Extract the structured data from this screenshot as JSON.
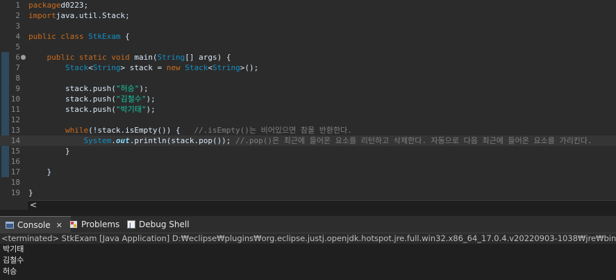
{
  "editor": {
    "lines": [
      {
        "num": "1",
        "tokens": [
          [
            "kw",
            "package"
          ],
          [
            "",
            "d0223;"
          ]
        ]
      },
      {
        "num": "2",
        "tokens": [
          [
            "kw",
            "import"
          ],
          [
            "",
            "java.util.Stack;"
          ]
        ]
      },
      {
        "num": "3",
        "tokens": []
      },
      {
        "num": "4",
        "tokens": [
          [
            "kw",
            "public class "
          ],
          [
            "cls",
            "StkExam"
          ],
          [
            "",
            " {"
          ]
        ]
      },
      {
        "num": "5",
        "tokens": []
      },
      {
        "num": "6",
        "tokens": [
          [
            "",
            "    "
          ],
          [
            "kw",
            "public static void "
          ],
          [
            "",
            "main("
          ],
          [
            "cls",
            "String"
          ],
          [
            "",
            "[] "
          ],
          [
            "",
            "args) {"
          ]
        ]
      },
      {
        "num": "7",
        "tokens": [
          [
            "",
            "        "
          ],
          [
            "cls",
            "Stack"
          ],
          [
            "",
            "<"
          ],
          [
            "cls",
            "String"
          ],
          [
            "",
            "> stack = "
          ],
          [
            "kw",
            "new "
          ],
          [
            "cls",
            "Stack"
          ],
          [
            "",
            "<"
          ],
          [
            "cls",
            "String"
          ],
          [
            "",
            ">();"
          ]
        ]
      },
      {
        "num": "8",
        "tokens": []
      },
      {
        "num": "9",
        "tokens": [
          [
            "",
            "        stack.push("
          ],
          [
            "str",
            "\"허승\""
          ],
          [
            "",
            ");"
          ]
        ]
      },
      {
        "num": "10",
        "tokens": [
          [
            "",
            "        stack.push("
          ],
          [
            "str",
            "\"김철수\""
          ],
          [
            "",
            ");"
          ]
        ]
      },
      {
        "num": "11",
        "tokens": [
          [
            "",
            "        stack.push("
          ],
          [
            "str",
            "\"박기태\""
          ],
          [
            "",
            ");"
          ]
        ]
      },
      {
        "num": "12",
        "tokens": []
      },
      {
        "num": "13",
        "tokens": [
          [
            "",
            "        "
          ],
          [
            "kw",
            "while"
          ],
          [
            "",
            "(!stack.isEmpty()) {   "
          ],
          [
            "cm",
            "//.isEmpty()는 비어있으면 참을 반환한다."
          ]
        ]
      },
      {
        "num": "14",
        "tokens": [
          [
            "",
            "            "
          ],
          [
            "cls",
            "System"
          ],
          [
            "",
            "."
          ],
          [
            "ital",
            "out"
          ],
          [
            "",
            ".println(stack.pop()); "
          ],
          [
            "cm",
            "//.pop()은 최근에 들어온 요소를 리턴하고 삭제한다. 자동으로 다음 최근에 들어온 요소를 가리킨다."
          ]
        ]
      },
      {
        "num": "15",
        "tokens": [
          [
            "",
            "        }"
          ]
        ]
      },
      {
        "num": "16",
        "tokens": []
      },
      {
        "num": "17",
        "tokens": [
          [
            "",
            "    }"
          ]
        ]
      },
      {
        "num": "18",
        "tokens": []
      },
      {
        "num": "19",
        "tokens": [
          [
            "",
            "}"
          ]
        ]
      }
    ]
  },
  "hscroll": {
    "left_arrow": "<"
  },
  "tabs": [
    {
      "label": "Console",
      "icon": "console-icon",
      "active": true,
      "close": "✕"
    },
    {
      "label": "Problems",
      "icon": "problems-icon",
      "active": false
    },
    {
      "label": "Debug Shell",
      "icon": "debug-shell-icon",
      "active": false
    }
  ],
  "status": {
    "text": "<terminated> StkExam [Java Application] D:₩eclipse₩plugins₩org.eclipse.justj.openjdk.hotspot.jre.full.win32.x86_64_17.0.4.v20220903-1038₩jre₩bin₩javaw.exe  ("
  },
  "output": {
    "lines": [
      "박기태",
      "김철수",
      "허승"
    ]
  },
  "colors": {
    "keyword": "#cc6c1d",
    "class": "#1290c3",
    "string": "#17c6a3",
    "comment": "#808080",
    "editor_bg": "#2b2b2b"
  }
}
